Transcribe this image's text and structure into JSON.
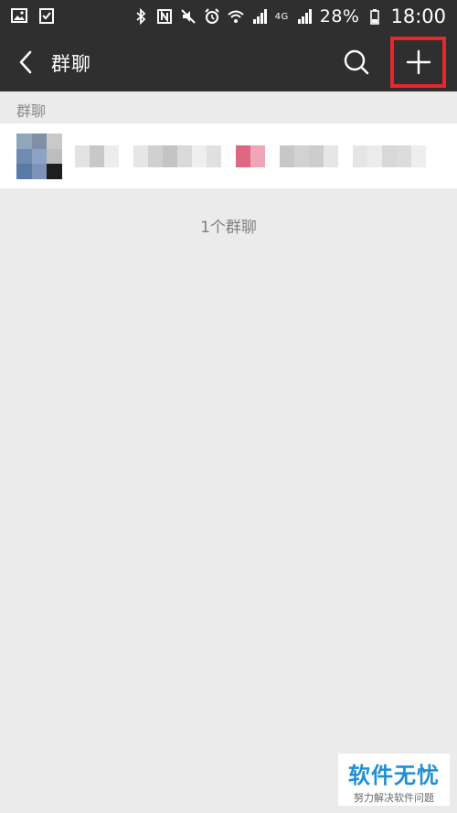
{
  "status_bar": {
    "battery": "28%",
    "time": "18:00",
    "network_label": "4G"
  },
  "header": {
    "title": "群聊",
    "back_icon": "chevron-left-icon",
    "search_icon": "search-icon",
    "add_icon": "plus-icon"
  },
  "section": {
    "header": "群聊"
  },
  "group_list": {
    "items": [
      {
        "name_pixelated": true,
        "avatar_colors": [
          "#8fa6bd",
          "#7f8fa8",
          "#c9c9c9",
          "#6f8cb0",
          "#8ea3c3",
          "#bdbdbd",
          "#5a7aa6",
          "#7b93b7",
          "#1e1e1e"
        ],
        "name_colors": [
          "#e3e3e3",
          "#c8c8c8",
          "#ededed",
          "#ffffff",
          "#e6e6e6",
          "#d0d0d0",
          "#c4c4c4",
          "#dadada",
          "#efefef",
          "#e0e0e0",
          "#ffffff",
          "#e06783",
          "#f0a6b8",
          "#ffffff",
          "#c7c7c7",
          "#d2d2d2",
          "#cdcdcd",
          "#e6e6e6",
          "#ffffff",
          "#e5e5e5",
          "#ececec",
          "#d8d8d8",
          "#dcdcdc",
          "#eeeeee"
        ]
      }
    ],
    "count_text": "1个群聊"
  },
  "watermark": {
    "title": "软件无忧",
    "subtitle": "努力解决软件问题"
  },
  "colors": {
    "bar_bg": "#2f2f2f",
    "page_bg": "#ebebeb",
    "highlight": "#e8262b",
    "watermark_blue": "#1f8fd6"
  }
}
